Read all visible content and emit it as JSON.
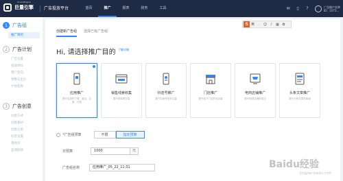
{
  "brand": {
    "name": "巨量引擎",
    "sub": "OceanEngine",
    "platform": "广告投放平台"
  },
  "nav": [
    "首页",
    "推广",
    "报表",
    "财务",
    "工具"
  ],
  "account": {
    "name": "广告账户名称",
    "id": "ID：1073…"
  },
  "steps": [
    {
      "num": "1",
      "label": "广告组",
      "subs": [
        "推广目的"
      ]
    },
    {
      "num": "2",
      "label": "广告计划",
      "subs": [
        "广告位置",
        "投放目标",
        "用户定向",
        "预算与出价",
        "计划名称"
      ]
    },
    {
      "num": "3",
      "label": "广告创意",
      "subs": [
        "创意方式",
        "创意素材",
        "创意分类",
        "标签设置",
        "落地页",
        "监测链接"
      ]
    }
  ],
  "tabs": [
    "创建新广告组",
    "选择已有广告组"
  ],
  "title": "Hi, 请选择推广目的",
  "learn_more": "了解详情",
  "cards": [
    {
      "name": "应用推广",
      "desc": "提升应用的下载、激活、注册、付费",
      "icon": "phone-app-icon"
    },
    {
      "name": "销售线索收集",
      "desc": "提升表单提交量",
      "icon": "browser-window-icon"
    },
    {
      "name": "抖音号推广",
      "desc": "提升抖音号的关注量",
      "icon": "phone-account-icon"
    },
    {
      "name": "门店推广",
      "desc": "提升线下门店的到店量",
      "icon": "store-icon"
    },
    {
      "name": "电商店铺推广",
      "desc": "提升电商店铺的成交",
      "icon": "shop-cart-icon"
    },
    {
      "name": "头条文章推广",
      "desc": "提升头条文章的阅读",
      "icon": "article-icon"
    }
  ],
  "form": {
    "budget_type_label": "广告组预算",
    "budget_options": [
      "不限",
      "指定预算"
    ],
    "daily_budget_label": "日预算",
    "daily_budget_value": "1000",
    "unit": "元",
    "group_name_label": "广告组名称",
    "group_name_value": "应用推广_05_22_11:31"
  },
  "colors": {
    "accent": "#2f88ff",
    "topbar": "#1f2a44"
  },
  "watermark": {
    "text": "Baidu经验",
    "sub": "jingyan.baidu.com"
  }
}
